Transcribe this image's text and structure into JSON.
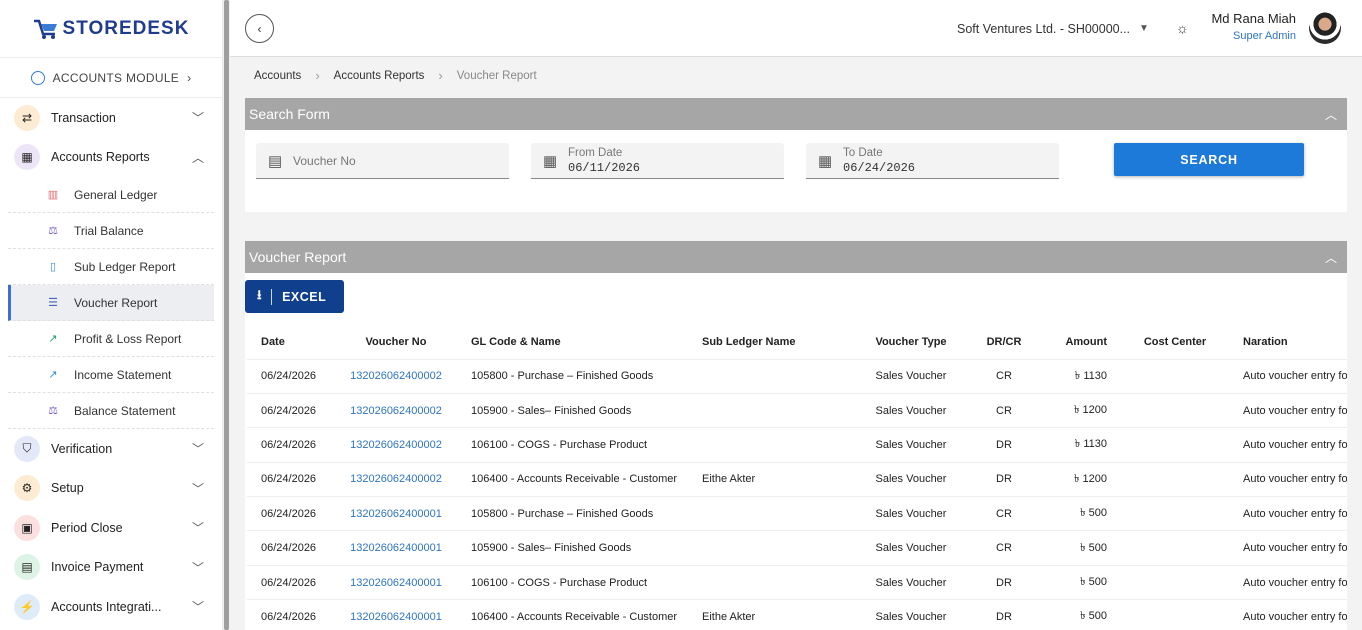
{
  "brand": {
    "name": "STOREDESK"
  },
  "module": {
    "label": "ACCOUNTS MODULE"
  },
  "sidebar": {
    "items": [
      {
        "label": "Transaction",
        "icon": "arrows-icon",
        "color": "#fdebd3",
        "expanded": false
      },
      {
        "label": "Accounts Reports",
        "icon": "calculator-icon",
        "color": "#ece5f8",
        "expanded": true
      },
      {
        "label": "Verification",
        "icon": "shield-icon",
        "color": "#e4e9f9",
        "expanded": false
      },
      {
        "label": "Setup",
        "icon": "gear-icon",
        "color": "#fdebd3",
        "expanded": false
      },
      {
        "label": "Period Close",
        "icon": "calendar-icon",
        "color": "#fbe0e0",
        "expanded": false
      },
      {
        "label": "Invoice Payment",
        "icon": "invoice-icon",
        "color": "#ddf3e6",
        "expanded": false
      },
      {
        "label": "Accounts Integrati...",
        "icon": "plug-icon",
        "color": "#ddecf8",
        "expanded": false
      }
    ],
    "subitems": [
      {
        "label": "General Ledger",
        "icon": "book-icon",
        "color": "#e26b6b"
      },
      {
        "label": "Trial Balance",
        "icon": "scale-icon",
        "color": "#7a5cc8"
      },
      {
        "label": "Sub Ledger Report",
        "icon": "notebook-icon",
        "color": "#2e8fd6"
      },
      {
        "label": "Voucher Report",
        "icon": "list-icon",
        "color": "#4a5fc1",
        "active": true
      },
      {
        "label": "Profit & Loss Report",
        "icon": "trend-icon",
        "color": "#28a06a"
      },
      {
        "label": "Income Statement",
        "icon": "trend-icon",
        "color": "#2e8fd6"
      },
      {
        "label": "Balance Statement",
        "icon": "balance-icon",
        "color": "#7a5cc8"
      }
    ]
  },
  "topbar": {
    "company": "Soft Ventures Ltd. - SH00000...",
    "user_name": "Md Rana Miah",
    "user_role": "Super Admin"
  },
  "breadcrumb": [
    "Accounts",
    "Accounts Reports",
    "Voucher Report"
  ],
  "search_form": {
    "title": "Search Form",
    "voucher_placeholder": "Voucher No",
    "from_label": "From Date",
    "from_value": "06/11/2026",
    "to_label": "To Date",
    "to_value": "06/24/2026",
    "search_label": "SEARCH"
  },
  "report": {
    "title": "Voucher Report",
    "excel_label": "EXCEL",
    "columns": [
      "Date",
      "Voucher No",
      "GL Code & Name",
      "Sub Ledger Name",
      "Voucher Type",
      "DR/CR",
      "Amount",
      "Cost Center",
      "Naration"
    ],
    "rows": [
      [
        "06/24/2026",
        "132026062400002",
        "105800 - Purchase – Finished Goods",
        "",
        "Sales Voucher",
        "CR",
        "৳ 1130",
        "",
        "Auto voucher entry for s"
      ],
      [
        "06/24/2026",
        "132026062400002",
        "105900 - Sales– Finished Goods",
        "",
        "Sales Voucher",
        "CR",
        "৳ 1200",
        "",
        "Auto voucher entry for s"
      ],
      [
        "06/24/2026",
        "132026062400002",
        "106100 - COGS - Purchase Product",
        "",
        "Sales Voucher",
        "DR",
        "৳ 1130",
        "",
        "Auto voucher entry for s"
      ],
      [
        "06/24/2026",
        "132026062400002",
        "106400 - Accounts Receivable - Customer",
        "Eithe Akter",
        "Sales Voucher",
        "DR",
        "৳ 1200",
        "",
        "Auto voucher entry for s"
      ],
      [
        "06/24/2026",
        "132026062400001",
        "105800 - Purchase – Finished Goods",
        "",
        "Sales Voucher",
        "CR",
        "৳ 500",
        "",
        "Auto voucher entry for s"
      ],
      [
        "06/24/2026",
        "132026062400001",
        "105900 - Sales– Finished Goods",
        "",
        "Sales Voucher",
        "CR",
        "৳ 500",
        "",
        "Auto voucher entry for s"
      ],
      [
        "06/24/2026",
        "132026062400001",
        "106100 - COGS - Purchase Product",
        "",
        "Sales Voucher",
        "DR",
        "৳ 500",
        "",
        "Auto voucher entry for s"
      ],
      [
        "06/24/2026",
        "132026062400001",
        "106400 - Accounts Receivable - Customer",
        "Eithe Akter",
        "Sales Voucher",
        "DR",
        "৳ 500",
        "",
        "Auto voucher entry for s"
      ]
    ]
  }
}
